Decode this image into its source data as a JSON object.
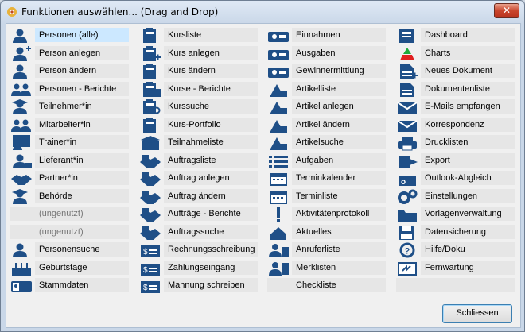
{
  "window": {
    "title": "Funktionen auswählen... (Drag and Drop)",
    "close_label": "✕"
  },
  "columns": [
    {
      "items": [
        {
          "label": "Personen (alle)",
          "icon": "person-icon",
          "selected": true
        },
        {
          "label": "Person anlegen",
          "icon": "person-add-icon"
        },
        {
          "label": "Person ändern",
          "icon": "person-edit-icon"
        },
        {
          "label": "Personen - Berichte",
          "icon": "persons-report-icon"
        },
        {
          "label": "Teilnehmer*in",
          "icon": "graduate-icon"
        },
        {
          "label": "Mitarbeiter*in",
          "icon": "employees-icon"
        },
        {
          "label": "Trainer*in",
          "icon": "trainer-icon"
        },
        {
          "label": "Lieferant*in",
          "icon": "supplier-icon"
        },
        {
          "label": "Partner*in",
          "icon": "handshake-icon"
        },
        {
          "label": "Behörde",
          "icon": "authority-icon"
        },
        {
          "label": "(ungenutzt)",
          "icon": "",
          "empty": true
        },
        {
          "label": "(ungenutzt)",
          "icon": "",
          "empty": true
        },
        {
          "label": "Personensuche",
          "icon": "person-search-icon"
        },
        {
          "label": "Geburtstage",
          "icon": "birthday-icon"
        },
        {
          "label": "Stammdaten",
          "icon": "master-data-icon"
        }
      ]
    },
    {
      "items": [
        {
          "label": "Kursliste",
          "icon": "course-list-icon"
        },
        {
          "label": "Kurs anlegen",
          "icon": "course-add-icon"
        },
        {
          "label": "Kurs ändern",
          "icon": "course-edit-icon"
        },
        {
          "label": "Kurse - Berichte",
          "icon": "courses-report-icon"
        },
        {
          "label": "Kurssuche",
          "icon": "course-search-icon"
        },
        {
          "label": "Kurs-Portfolio",
          "icon": "course-portfolio-icon"
        },
        {
          "label": "Teilnahmeliste",
          "icon": "attendance-list-icon"
        },
        {
          "label": "Auftragsliste",
          "icon": "order-list-icon"
        },
        {
          "label": "Auftrag anlegen",
          "icon": "order-add-icon"
        },
        {
          "label": "Auftrag ändern",
          "icon": "order-edit-icon"
        },
        {
          "label": "Aufträge - Berichte",
          "icon": "orders-report-icon"
        },
        {
          "label": "Auftragssuche",
          "icon": "order-search-icon"
        },
        {
          "label": "Rechnungsschreibung",
          "icon": "invoice-icon"
        },
        {
          "label": "Zahlungseingang",
          "icon": "payment-icon"
        },
        {
          "label": "Mahnung schreiben",
          "icon": "reminder-icon"
        }
      ]
    },
    {
      "items": [
        {
          "label": "Einnahmen",
          "icon": "income-icon"
        },
        {
          "label": "Ausgaben",
          "icon": "expenses-icon"
        },
        {
          "label": "Gewinnermittlung",
          "icon": "profit-icon"
        },
        {
          "label": "Artikelliste",
          "icon": "article-list-icon"
        },
        {
          "label": "Artikel anlegen",
          "icon": "article-add-icon"
        },
        {
          "label": "Artikel ändern",
          "icon": "article-edit-icon"
        },
        {
          "label": "Artikelsuche",
          "icon": "article-search-icon"
        },
        {
          "label": "Aufgaben",
          "icon": "tasks-icon"
        },
        {
          "label": "Terminkalender",
          "icon": "calendar-icon"
        },
        {
          "label": "Terminliste",
          "icon": "appointment-list-icon"
        },
        {
          "label": "Aktivitätenprotokoll",
          "icon": "activity-log-icon"
        },
        {
          "label": "Aktuelles",
          "icon": "news-icon"
        },
        {
          "label": "Anruferliste",
          "icon": "caller-list-icon"
        },
        {
          "label": "Merklisten",
          "icon": "watchlist-icon"
        },
        {
          "label": "Checkliste",
          "icon": "",
          "noicon": true
        }
      ]
    },
    {
      "items": [
        {
          "label": "Dashboard",
          "icon": "dashboard-icon"
        },
        {
          "label": "Charts",
          "icon": "charts-icon"
        },
        {
          "label": "Neues Dokument",
          "icon": "new-document-icon"
        },
        {
          "label": "Dokumentenliste",
          "icon": "document-list-icon"
        },
        {
          "label": "E-Mails empfangen",
          "icon": "email-icon"
        },
        {
          "label": "Korrespondenz",
          "icon": "correspondence-icon"
        },
        {
          "label": "Drucklisten",
          "icon": "print-list-icon"
        },
        {
          "label": "Export",
          "icon": "export-icon"
        },
        {
          "label": "Outlook-Abgleich",
          "icon": "outlook-sync-icon"
        },
        {
          "label": "Einstellungen",
          "icon": "settings-icon"
        },
        {
          "label": "Vorlagenverwaltung",
          "icon": "templates-icon"
        },
        {
          "label": "Datensicherung",
          "icon": "backup-icon"
        },
        {
          "label": "Hilfe/Doku",
          "icon": "help-icon"
        },
        {
          "label": "Fernwartung",
          "icon": "remote-icon"
        },
        {
          "label": "",
          "icon": "",
          "blank": true
        }
      ]
    }
  ],
  "footer": {
    "close_button": "Schliessen"
  },
  "colors": {
    "icon": "#1f4f87",
    "selected": "#cce8ff",
    "tile": "#e6e6e6",
    "charts_red": "#e02020",
    "charts_green": "#1faa3a"
  }
}
